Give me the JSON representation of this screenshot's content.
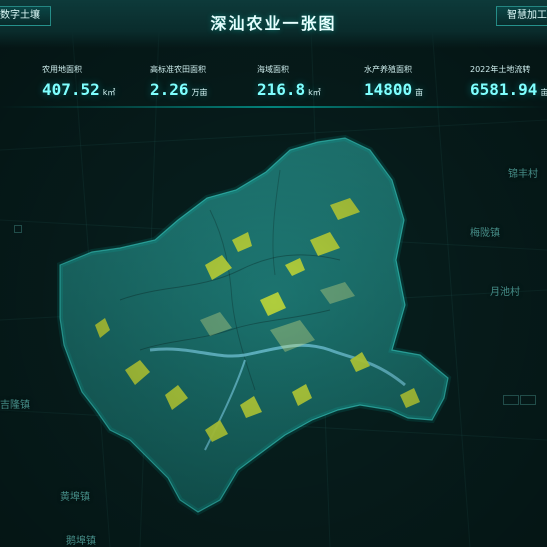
{
  "header": {
    "title": "深汕农业一张图",
    "left_tab": "数字土壤",
    "right_tab": "智慧加工"
  },
  "stats": [
    {
      "label": "农用地面积",
      "value": "407.52",
      "unit": "k㎡"
    },
    {
      "label": "高标准农田面积",
      "value": "2.26",
      "unit": "万亩"
    },
    {
      "label": "海域面积",
      "value": "216.8",
      "unit": "k㎡"
    },
    {
      "label": "水产养殖面积",
      "value": "14800",
      "unit": "亩"
    },
    {
      "label": "2022年土地流转",
      "value": "6581.94",
      "unit": "亩"
    }
  ],
  "map": {
    "place_names": {
      "right_top": "锦丰村",
      "right_mid": "梅陇镇",
      "right_low": "月池村",
      "left_low": "吉隆镇",
      "bottom_left": "黄埠镇",
      "bottom_left_2": "鹅埠镇"
    }
  },
  "colors": {
    "accent": "#7fffff",
    "background": "#07201f",
    "map_fill": "#1f7e79",
    "field_fill": "#b7d23b",
    "water_fill": "#6cc2d4"
  }
}
